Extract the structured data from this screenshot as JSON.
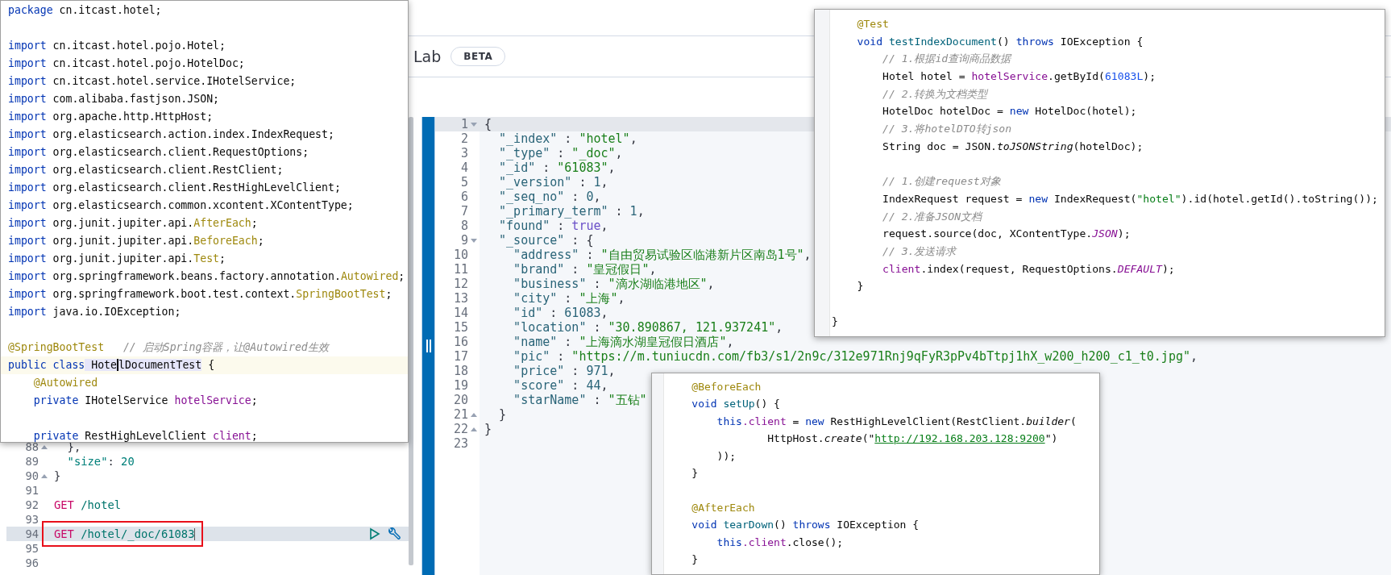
{
  "header": {
    "tab": "Lab",
    "badge": "BETA"
  },
  "console": {
    "lines": [
      {
        "number": "88",
        "fold": {
          "kind": "close"
        },
        "current": false,
        "boxed": false,
        "tokens": [
          {
            "kind": "plain",
            "text": "  },"
          }
        ]
      },
      {
        "number": "89",
        "current": false,
        "boxed": false,
        "tokens": [
          {
            "kind": "ckey",
            "text": "  \"size\""
          },
          {
            "kind": "plain",
            "text": ":"
          },
          {
            "kind": "cnum",
            "text": " 20"
          }
        ]
      },
      {
        "number": "90",
        "fold": {
          "kind": "close"
        },
        "current": false,
        "boxed": false,
        "tokens": [
          {
            "kind": "plain",
            "text": "}"
          }
        ]
      },
      {
        "number": "91",
        "current": false,
        "boxed": false
      },
      {
        "number": "92",
        "current": false,
        "boxed": false,
        "tokens": [
          {
            "kind": "method",
            "text": "GET"
          },
          {
            "kind": "path",
            "text": " /hotel"
          }
        ]
      },
      {
        "number": "93",
        "current": false,
        "boxed": false
      },
      {
        "number": "94",
        "current": true,
        "boxed": true,
        "tokens": [
          {
            "kind": "method",
            "text": "GET"
          },
          {
            "kind": "path-caret",
            "text": " /hotel/_doc/61083"
          }
        ]
      },
      {
        "number": "95",
        "current": false,
        "boxed": false
      },
      {
        "number": "96",
        "current": false,
        "boxed": false
      }
    ]
  },
  "output": {
    "lines": [
      {
        "number": "1",
        "fold": {
          "kind": "open"
        },
        "current": true,
        "tokens": [
          {
            "kind": "plain",
            "text": "{"
          }
        ]
      },
      {
        "number": "2",
        "current": false,
        "tokens": [
          {
            "kind": "key",
            "text": "  \"_index\""
          },
          {
            "kind": "plain",
            "text": " :"
          },
          {
            "kind": "jstr",
            "text": " \"hotel\""
          },
          {
            "kind": "plain",
            "text": ","
          }
        ]
      },
      {
        "number": "3",
        "current": false,
        "tokens": [
          {
            "kind": "key",
            "text": "  \"_type\""
          },
          {
            "kind": "plain",
            "text": " :"
          },
          {
            "kind": "jstr",
            "text": " \"_doc\""
          },
          {
            "kind": "plain",
            "text": ","
          }
        ]
      },
      {
        "number": "4",
        "current": false,
        "tokens": [
          {
            "kind": "key",
            "text": "  \"_id\""
          },
          {
            "kind": "plain",
            "text": " :"
          },
          {
            "kind": "jstr",
            "text": " \"61083\""
          },
          {
            "kind": "plain",
            "text": ","
          }
        ]
      },
      {
        "number": "5",
        "current": false,
        "tokens": [
          {
            "kind": "key",
            "text": "  \"_version\""
          },
          {
            "kind": "plain",
            "text": " :"
          },
          {
            "kind": "jnum",
            "text": " 1"
          },
          {
            "kind": "plain",
            "text": ","
          }
        ]
      },
      {
        "number": "6",
        "current": false,
        "tokens": [
          {
            "kind": "key",
            "text": "  \"_seq_no\""
          },
          {
            "kind": "plain",
            "text": " :"
          },
          {
            "kind": "jnum",
            "text": " 0"
          },
          {
            "kind": "plain",
            "text": ","
          }
        ]
      },
      {
        "number": "7",
        "current": false,
        "tokens": [
          {
            "kind": "key",
            "text": "  \"_primary_term\""
          },
          {
            "kind": "plain",
            "text": " :"
          },
          {
            "kind": "jnum",
            "text": " 1"
          },
          {
            "kind": "plain",
            "text": ","
          }
        ]
      },
      {
        "number": "8",
        "current": false,
        "tokens": [
          {
            "kind": "key",
            "text": "  \"found\""
          },
          {
            "kind": "plain",
            "text": " :"
          },
          {
            "kind": "bool",
            "text": " true"
          },
          {
            "kind": "plain",
            "text": ","
          }
        ]
      },
      {
        "number": "9",
        "fold": {
          "kind": "open"
        },
        "current": false,
        "tokens": [
          {
            "kind": "key",
            "text": "  \"_source\""
          },
          {
            "kind": "plain",
            "text": " : {"
          }
        ]
      },
      {
        "number": "10",
        "current": false,
        "tokens": [
          {
            "kind": "key",
            "text": "    \"address\""
          },
          {
            "kind": "plain",
            "text": " :"
          },
          {
            "kind": "jstr",
            "text": " \"自由贸易试验区临港新片区南岛1号\""
          },
          {
            "kind": "plain",
            "text": ","
          }
        ]
      },
      {
        "number": "11",
        "current": false,
        "tokens": [
          {
            "kind": "key",
            "text": "    \"brand\""
          },
          {
            "kind": "plain",
            "text": " :"
          },
          {
            "kind": "jstr",
            "text": " \"皇冠假日\""
          },
          {
            "kind": "plain",
            "text": ","
          }
        ]
      },
      {
        "number": "12",
        "current": false,
        "tokens": [
          {
            "kind": "key",
            "text": "    \"business\""
          },
          {
            "kind": "plain",
            "text": " :"
          },
          {
            "kind": "jstr",
            "text": " \"滴水湖临港地区\""
          },
          {
            "kind": "plain",
            "text": ","
          }
        ]
      },
      {
        "number": "13",
        "current": false,
        "tokens": [
          {
            "kind": "key",
            "text": "    \"city\""
          },
          {
            "kind": "plain",
            "text": " :"
          },
          {
            "kind": "jstr",
            "text": " \"上海\""
          },
          {
            "kind": "plain",
            "text": ","
          }
        ]
      },
      {
        "number": "14",
        "current": false,
        "tokens": [
          {
            "kind": "key",
            "text": "    \"id\""
          },
          {
            "kind": "plain",
            "text": " :"
          },
          {
            "kind": "jnum",
            "text": " 61083"
          },
          {
            "kind": "plain",
            "text": ","
          }
        ]
      },
      {
        "number": "15",
        "current": false,
        "tokens": [
          {
            "kind": "key",
            "text": "    \"location\""
          },
          {
            "kind": "plain",
            "text": " :"
          },
          {
            "kind": "jstr",
            "text": " \"30.890867, 121.937241\""
          },
          {
            "kind": "plain",
            "text": ","
          }
        ]
      },
      {
        "number": "16",
        "current": false,
        "tokens": [
          {
            "kind": "key",
            "text": "    \"name\""
          },
          {
            "kind": "plain",
            "text": " :"
          },
          {
            "kind": "jstr",
            "text": " \"上海滴水湖皇冠假日酒店\""
          },
          {
            "kind": "plain",
            "text": ","
          }
        ]
      },
      {
        "number": "17",
        "current": false,
        "tokens": [
          {
            "kind": "key",
            "text": "    \"pic\""
          },
          {
            "kind": "plain",
            "text": " :"
          },
          {
            "kind": "jstr",
            "text": " \"https://m.tuniucdn.com/fb3/s1/2n9c/312e971Rnj9qFyR3pPv4bTtpj1hX_w200_h200_c1_t0.jpg\""
          },
          {
            "kind": "plain",
            "text": ","
          }
        ]
      },
      {
        "number": "18",
        "current": false,
        "tokens": [
          {
            "kind": "key",
            "text": "    \"price\""
          },
          {
            "kind": "plain",
            "text": " :"
          },
          {
            "kind": "jnum",
            "text": " 971"
          },
          {
            "kind": "plain",
            "text": ","
          }
        ]
      },
      {
        "number": "19",
        "current": false,
        "tokens": [
          {
            "kind": "key",
            "text": "    \"score\""
          },
          {
            "kind": "plain",
            "text": " :"
          },
          {
            "kind": "jnum",
            "text": " 44"
          },
          {
            "kind": "plain",
            "text": ","
          }
        ]
      },
      {
        "number": "20",
        "current": false,
        "tokens": [
          {
            "kind": "key",
            "text": "    \"starName\""
          },
          {
            "kind": "plain",
            "text": " :"
          },
          {
            "kind": "jstr",
            "text": " \"五钻\""
          }
        ]
      },
      {
        "number": "21",
        "fold": {
          "kind": "close"
        },
        "current": false,
        "tokens": [
          {
            "kind": "plain",
            "text": "  }"
          }
        ]
      },
      {
        "number": "22",
        "fold": {
          "kind": "close"
        },
        "current": false,
        "tokens": [
          {
            "kind": "plain",
            "text": "}"
          }
        ]
      },
      {
        "number": "23",
        "current": false
      }
    ]
  },
  "code_windows": [
    {
      "lines": [
        {
          "kind": "code",
          "current": false,
          "tokens": [
            {
              "kind": "kw",
              "text": "package"
            },
            {
              "kind": "plain",
              "text": " cn.itcast.hotel;"
            }
          ]
        },
        {
          "kind": "blank",
          "current": false
        },
        {
          "kind": "code",
          "current": false,
          "tokens": [
            {
              "kind": "kw",
              "text": "import"
            },
            {
              "kind": "plain",
              "text": " cn.itcast.hotel.pojo.Hotel;"
            }
          ]
        },
        {
          "kind": "code",
          "current": false,
          "tokens": [
            {
              "kind": "kw",
              "text": "import"
            },
            {
              "kind": "plain",
              "text": " cn.itcast.hotel.pojo.HotelDoc;"
            }
          ]
        },
        {
          "kind": "code",
          "current": false,
          "tokens": [
            {
              "kind": "kw",
              "text": "import"
            },
            {
              "kind": "plain",
              "text": " cn.itcast.hotel.service.IHotelService;"
            }
          ]
        },
        {
          "kind": "code",
          "current": false,
          "tokens": [
            {
              "kind": "kw",
              "text": "import"
            },
            {
              "kind": "plain",
              "text": " com.alibaba.fastjson.JSON;"
            }
          ]
        },
        {
          "kind": "code",
          "current": false,
          "tokens": [
            {
              "kind": "kw",
              "text": "import"
            },
            {
              "kind": "plain",
              "text": " org.apache.http.HttpHost;"
            }
          ]
        },
        {
          "kind": "code",
          "current": false,
          "tokens": [
            {
              "kind": "kw",
              "text": "import"
            },
            {
              "kind": "plain",
              "text": " org.elasticsearch.action.index.IndexRequest;"
            }
          ]
        },
        {
          "kind": "code",
          "current": false,
          "tokens": [
            {
              "kind": "kw",
              "text": "import"
            },
            {
              "kind": "plain",
              "text": " org.elasticsearch.client.RequestOptions;"
            }
          ]
        },
        {
          "kind": "code",
          "current": false,
          "tokens": [
            {
              "kind": "kw",
              "text": "import"
            },
            {
              "kind": "plain",
              "text": " org.elasticsearch.client.RestClient;"
            }
          ]
        },
        {
          "kind": "code",
          "current": false,
          "tokens": [
            {
              "kind": "kw",
              "text": "import"
            },
            {
              "kind": "plain",
              "text": " org.elasticsearch.client.RestHighLevelClient;"
            }
          ]
        },
        {
          "kind": "code",
          "current": false,
          "tokens": [
            {
              "kind": "kw",
              "text": "import"
            },
            {
              "kind": "plain",
              "text": " org.elasticsearch.common.xcontent.XContentType;"
            }
          ]
        },
        {
          "kind": "code",
          "current": false,
          "tokens": [
            {
              "kind": "kw",
              "text": "import"
            },
            {
              "kind": "plain",
              "text": " org.junit.jupiter.api."
            },
            {
              "kind": "ann",
              "text": "AfterEach"
            },
            {
              "kind": "plain",
              "text": ";"
            }
          ]
        },
        {
          "kind": "code",
          "current": false,
          "tokens": [
            {
              "kind": "kw",
              "text": "import"
            },
            {
              "kind": "plain",
              "text": " org.junit.jupiter.api."
            },
            {
              "kind": "ann",
              "text": "BeforeEach"
            },
            {
              "kind": "plain",
              "text": ";"
            }
          ]
        },
        {
          "kind": "code",
          "current": false,
          "tokens": [
            {
              "kind": "kw",
              "text": "import"
            },
            {
              "kind": "plain",
              "text": " org.junit.jupiter.api."
            },
            {
              "kind": "ann",
              "text": "Test"
            },
            {
              "kind": "plain",
              "text": ";"
            }
          ]
        },
        {
          "kind": "code",
          "current": false,
          "tokens": [
            {
              "kind": "kw",
              "text": "import"
            },
            {
              "kind": "plain",
              "text": " org.springframework.beans.factory.annotation."
            },
            {
              "kind": "ann",
              "text": "Autowired"
            },
            {
              "kind": "plain",
              "text": ";"
            }
          ]
        },
        {
          "kind": "code",
          "current": false,
          "tokens": [
            {
              "kind": "kw",
              "text": "import"
            },
            {
              "kind": "plain",
              "text": " org.springframework.boot.test.context."
            },
            {
              "kind": "ann",
              "text": "SpringBootTest"
            },
            {
              "kind": "plain",
              "text": ";"
            }
          ]
        },
        {
          "kind": "code",
          "current": false,
          "tokens": [
            {
              "kind": "kw",
              "text": "import"
            },
            {
              "kind": "plain",
              "text": " java.io.IOException;"
            }
          ]
        },
        {
          "kind": "blank",
          "current": false
        },
        {
          "kind": "code",
          "current": false,
          "tokens": [
            {
              "kind": "ann",
              "text": "@SpringBootTest"
            },
            {
              "kind": "cmt",
              "text": "   // 启动Spring容器，让@Autowired生效"
            }
          ]
        },
        {
          "kind": "code",
          "current": true,
          "tokens": [
            {
              "kind": "kw",
              "text": "public class"
            },
            {
              "kind": "hl",
              "text": " Hote"
            },
            {
              "kind": "hlcaret",
              "text": "lDocumentTest"
            },
            {
              "kind": "plain",
              "text": " {"
            }
          ]
        },
        {
          "kind": "code",
          "current": false,
          "tokens": [
            {
              "kind": "ann",
              "text": "    @Autowired"
            }
          ]
        },
        {
          "kind": "code",
          "current": false,
          "tokens": [
            {
              "kind": "kw",
              "text": "    private"
            },
            {
              "kind": "plain",
              "text": " IHotelService"
            },
            {
              "kind": "fld",
              "text": " hotelService"
            },
            {
              "kind": "plain",
              "text": ";"
            }
          ]
        },
        {
          "kind": "blank",
          "current": false
        },
        {
          "kind": "code",
          "current": false,
          "tokens": [
            {
              "kind": "kw",
              "text": "    private"
            },
            {
              "kind": "plain",
              "text": " RestHighLevelClient"
            },
            {
              "kind": "fld",
              "text": " client"
            },
            {
              "kind": "plain",
              "text": ";"
            }
          ]
        }
      ]
    },
    {
      "lines": [
        {
          "kind": "code",
          "current": false,
          "tokens": [
            {
              "kind": "ann",
              "text": "    @Test"
            }
          ]
        },
        {
          "kind": "code",
          "current": false,
          "tokens": [
            {
              "kind": "kw",
              "text": "    void"
            },
            {
              "kind": "mdecl",
              "text": " testIndexDocument"
            },
            {
              "kind": "plain",
              "text": "()"
            },
            {
              "kind": "kw",
              "text": " throws"
            },
            {
              "kind": "plain",
              "text": " IOException {"
            }
          ]
        },
        {
          "kind": "code",
          "current": false,
          "tokens": [
            {
              "kind": "cmt",
              "text": "        // 1.根据id查询商品数据"
            }
          ]
        },
        {
          "kind": "code",
          "current": false,
          "tokens": [
            {
              "kind": "plain",
              "text": "        Hotel hotel ="
            },
            {
              "kind": "fld",
              "text": " hotelService"
            },
            {
              "kind": "plain",
              "text": ".getById("
            },
            {
              "kind": "num",
              "text": "61083L"
            },
            {
              "kind": "plain",
              "text": ");"
            }
          ]
        },
        {
          "kind": "code",
          "current": false,
          "tokens": [
            {
              "kind": "cmt",
              "text": "        // 2.转换为文档类型"
            }
          ]
        },
        {
          "kind": "code",
          "current": false,
          "tokens": [
            {
              "kind": "plain",
              "text": "        HotelDoc hotelDoc ="
            },
            {
              "kind": "kw",
              "text": " new"
            },
            {
              "kind": "plain",
              "text": " HotelDoc(hotel);"
            }
          ]
        },
        {
          "kind": "code",
          "current": false,
          "tokens": [
            {
              "kind": "cmt",
              "text": "        // 3.将hotelDTO转json"
            }
          ]
        },
        {
          "kind": "code",
          "current": false,
          "tokens": [
            {
              "kind": "plain",
              "text": "        String doc = JSON."
            },
            {
              "kind": "ital",
              "text": "toJSONString"
            },
            {
              "kind": "plain",
              "text": "(hotelDoc);"
            }
          ]
        },
        {
          "kind": "blank",
          "current": false
        },
        {
          "kind": "code",
          "current": false,
          "tokens": [
            {
              "kind": "cmt",
              "text": "        // 1.创建request对象"
            }
          ]
        },
        {
          "kind": "code",
          "current": false,
          "tokens": [
            {
              "kind": "plain",
              "text": "        IndexRequest request ="
            },
            {
              "kind": "kw",
              "text": " new"
            },
            {
              "kind": "plain",
              "text": " IndexRequest("
            },
            {
              "kind": "str",
              "text": "\"hotel\""
            },
            {
              "kind": "plain",
              "text": ").id(hotel.getId().toString());"
            }
          ]
        },
        {
          "kind": "code",
          "current": false,
          "tokens": [
            {
              "kind": "cmt",
              "text": "        // 2.准备JSON文档"
            }
          ]
        },
        {
          "kind": "code",
          "current": false,
          "tokens": [
            {
              "kind": "plain",
              "text": "        request.source(doc, XContentType."
            },
            {
              "kind": "const",
              "text": "JSON"
            },
            {
              "kind": "plain",
              "text": ");"
            }
          ]
        },
        {
          "kind": "code",
          "current": false,
          "tokens": [
            {
              "kind": "cmt",
              "text": "        // 3.发送请求"
            }
          ]
        },
        {
          "kind": "code",
          "current": false,
          "tokens": [
            {
              "kind": "fld",
              "text": "        client"
            },
            {
              "kind": "plain",
              "text": ".index(request, RequestOptions."
            },
            {
              "kind": "const",
              "text": "DEFAULT"
            },
            {
              "kind": "plain",
              "text": ");"
            }
          ]
        },
        {
          "kind": "code",
          "current": false,
          "tokens": [
            {
              "kind": "plain",
              "text": "    }"
            }
          ]
        },
        {
          "kind": "blank",
          "current": false
        },
        {
          "kind": "code",
          "current": false,
          "tokens": [
            {
              "kind": "plain",
              "text": "}"
            }
          ]
        }
      ]
    },
    {
      "lines": [
        {
          "kind": "code",
          "current": false,
          "tokens": [
            {
              "kind": "ann",
              "text": "    @BeforeEach"
            }
          ]
        },
        {
          "kind": "code",
          "current": false,
          "tokens": [
            {
              "kind": "kw",
              "text": "    void"
            },
            {
              "kind": "mdecl",
              "text": " setUp"
            },
            {
              "kind": "plain",
              "text": "() {"
            }
          ]
        },
        {
          "kind": "code",
          "current": false,
          "tokens": [
            {
              "kind": "kw",
              "text": "        this"
            },
            {
              "kind": "fld",
              "text": ".client"
            },
            {
              "kind": "plain",
              "text": " ="
            },
            {
              "kind": "kw",
              "text": " new"
            },
            {
              "kind": "plain",
              "text": " RestHighLevelClient(RestClient."
            },
            {
              "kind": "ital",
              "text": "builder"
            },
            {
              "kind": "plain",
              "text": "("
            }
          ]
        },
        {
          "kind": "code",
          "current": false,
          "tokens": [
            {
              "kind": "plain",
              "text": "                HttpHost."
            },
            {
              "kind": "ital",
              "text": "create"
            },
            {
              "kind": "plain",
              "text": "(\""
            },
            {
              "kind": "url",
              "text": "http://192.168.203.128:9200"
            },
            {
              "kind": "plain",
              "text": "\")"
            }
          ]
        },
        {
          "kind": "code",
          "current": false,
          "tokens": [
            {
              "kind": "plain",
              "text": "        ));"
            }
          ]
        },
        {
          "kind": "code",
          "current": false,
          "tokens": [
            {
              "kind": "plain",
              "text": "    }"
            }
          ]
        },
        {
          "kind": "blank",
          "current": false
        },
        {
          "kind": "code",
          "current": false,
          "tokens": [
            {
              "kind": "ann",
              "text": "    @AfterEach"
            }
          ]
        },
        {
          "kind": "code",
          "current": false,
          "tokens": [
            {
              "kind": "kw",
              "text": "    void"
            },
            {
              "kind": "mdecl",
              "text": " tearDown"
            },
            {
              "kind": "plain",
              "text": "()"
            },
            {
              "kind": "kw",
              "text": " throws"
            },
            {
              "kind": "plain",
              "text": " IOException {"
            }
          ]
        },
        {
          "kind": "code",
          "current": false,
          "tokens": [
            {
              "kind": "kw",
              "text": "        this"
            },
            {
              "kind": "fld",
              "text": ".client"
            },
            {
              "kind": "plain",
              "text": ".close();"
            }
          ]
        },
        {
          "kind": "code",
          "current": false,
          "tokens": [
            {
              "kind": "plain",
              "text": "    }"
            }
          ]
        }
      ]
    }
  ]
}
